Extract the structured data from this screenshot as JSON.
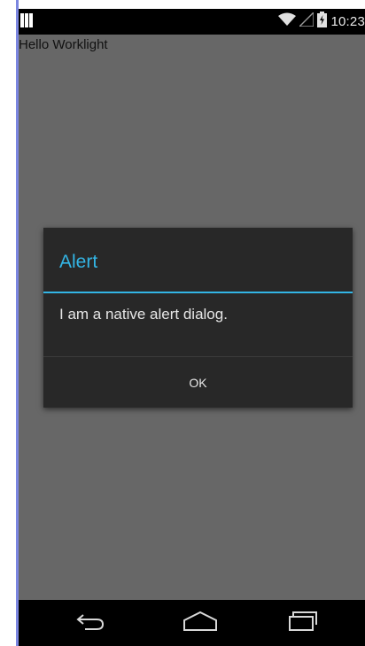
{
  "status_bar": {
    "time": "10:23",
    "icons": [
      "notification-icon",
      "wifi-icon",
      "signal-icon",
      "battery-charging-icon"
    ]
  },
  "app": {
    "title": "Hello Worklight"
  },
  "dialog": {
    "title": "Alert",
    "message": "I am a native alert dialog.",
    "ok_label": "OK"
  },
  "nav_bar": {
    "icons": [
      "back-icon",
      "home-icon",
      "recents-icon"
    ]
  },
  "colors": {
    "accent": "#33b5e5",
    "dialog_background": "#282828",
    "app_background": "#676767",
    "status_bar": "#000000",
    "nav_bar": "#000000"
  }
}
